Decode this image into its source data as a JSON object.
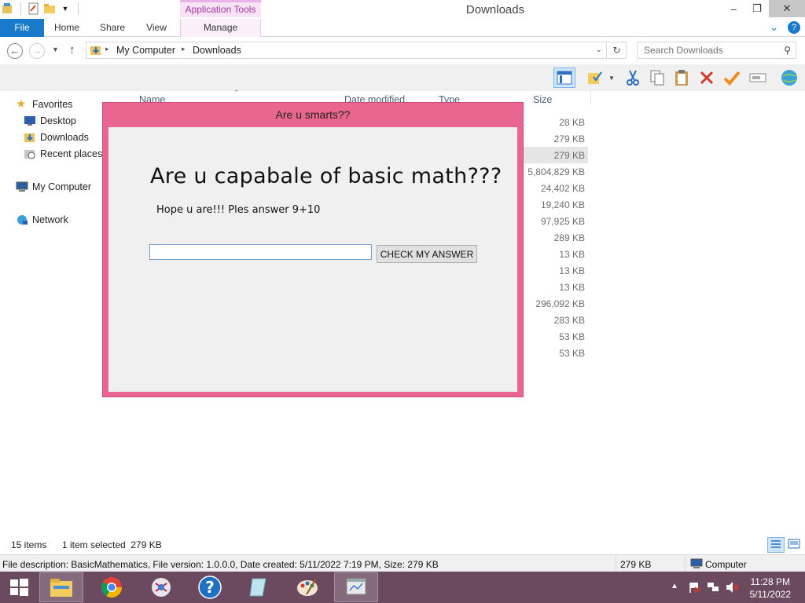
{
  "window": {
    "title": "Downloads",
    "contextual_tab_group": "Application Tools",
    "controls": {
      "minimize": "–",
      "maximize": "❐",
      "close": "✕"
    }
  },
  "ribbon": {
    "tabs": [
      {
        "label": "File"
      },
      {
        "label": "Home"
      },
      {
        "label": "Share"
      },
      {
        "label": "View"
      },
      {
        "label": "Manage"
      }
    ],
    "expand_glyph": "⌄",
    "help_glyph": "?"
  },
  "address": {
    "crumbs": [
      "My Computer",
      "Downloads"
    ],
    "separator": "▸"
  },
  "search": {
    "placeholder": "Search Downloads"
  },
  "nav_pane": {
    "favorites": "Favorites",
    "desktop": "Desktop",
    "downloads": "Downloads",
    "recent": "Recent places",
    "computer": "My Computer",
    "network": "Network"
  },
  "file_list": {
    "columns": {
      "name": "Name",
      "date": "Date modified",
      "type": "Type",
      "size": "Size"
    },
    "sizes": [
      "28 KB",
      "279 KB",
      "279 KB",
      "5,804,829 KB",
      "24,402 KB",
      "19,240 KB",
      "97,925 KB",
      "289 KB",
      "13 KB",
      "13 KB",
      "13 KB",
      "296,092 KB",
      "283 KB",
      "53 KB",
      "53 KB"
    ]
  },
  "dialog": {
    "title": "Are u smarts??",
    "heading": "Are u capabale of basic math???",
    "prompt": "Hope u are!!! Ples answer 9+10",
    "answer_value": "",
    "button": "CHECK MY ANSWER"
  },
  "status": {
    "item_count": "15 items",
    "selection": "1 item selected  279 KB",
    "description": "File description: BasicMathematics, File version: 1.0.0.0, Date created: 5/11/2022 7:19 PM, Size: 279 KB",
    "size": "279 KB",
    "location": "Computer"
  },
  "taskbar": {
    "time": "11:28 PM",
    "date": "5/11/2022",
    "tray_expand": "▲"
  }
}
